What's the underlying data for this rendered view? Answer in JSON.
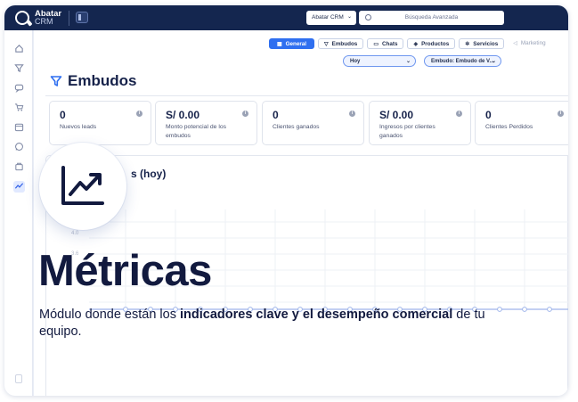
{
  "app": {
    "logo_line1": "Abatar",
    "logo_line2": "CRM"
  },
  "header": {
    "workspace_select": "Abatar CRM",
    "search_placeholder": "Búsqueda Avanzada"
  },
  "sidebar": {
    "items": [
      {
        "icon": "home-icon"
      },
      {
        "icon": "funnel-icon"
      },
      {
        "icon": "chat-icon"
      },
      {
        "icon": "cart-icon"
      },
      {
        "icon": "calendar-icon"
      },
      {
        "icon": "whatsapp-icon"
      },
      {
        "icon": "store-icon"
      },
      {
        "icon": "chart-icon",
        "active": true
      }
    ]
  },
  "tabs": [
    {
      "label": "General",
      "icon": "grid-icon",
      "active": true
    },
    {
      "label": "Embudos",
      "icon": "funnel-icon"
    },
    {
      "label": "Chats",
      "icon": "chat-icon"
    },
    {
      "label": "Productos",
      "icon": "box-icon"
    },
    {
      "label": "Servicios",
      "icon": "gear-icon"
    },
    {
      "label": "Marketing",
      "icon": "megaphone-icon"
    }
  ],
  "filters": {
    "period": "Hoy",
    "funnel": "Embudo: Embudo de V..."
  },
  "page_title": "Embudos",
  "kpis": [
    {
      "value": "0",
      "label": "Nuevos leads"
    },
    {
      "value": "S/ 0.00",
      "label": "Monto potencial de los embudos"
    },
    {
      "value": "0",
      "label": "Clientes ganados"
    },
    {
      "value": "S/ 0.00",
      "label": "Ingresos por clientes ganados"
    },
    {
      "value": "0",
      "label": "Clientes Perdidos"
    }
  ],
  "chart": {
    "title_fragment": "s (hoy)",
    "y_ticks": [
      "4.0",
      "3.6"
    ]
  },
  "hero": {
    "title": "Métricas",
    "desc_plain_1": "Módulo donde están los ",
    "desc_bold": "indicadores clave y el desempeño comercial",
    "desc_plain_2": " de tu equipo."
  },
  "colors": {
    "navy": "#14264f",
    "accent": "#2f6ff0",
    "title": "#121a3f"
  }
}
